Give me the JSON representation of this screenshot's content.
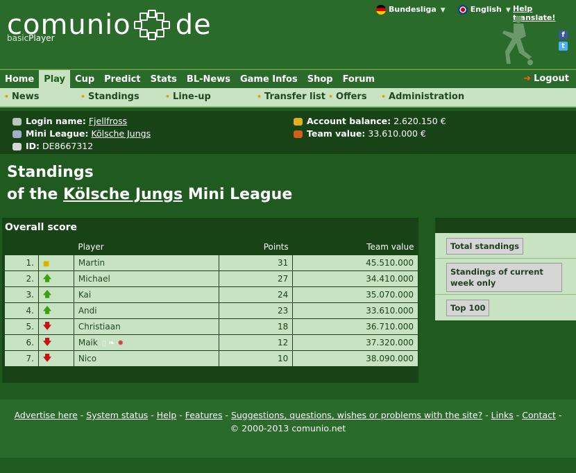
{
  "brand": {
    "name_left": "comunio",
    "name_right": "de",
    "sub_prefix": "basic",
    "sub_suffix": "Player"
  },
  "top": {
    "league": "Bundesliga",
    "language": "English",
    "help": "Help translate!",
    "fb": "f",
    "tw": "t"
  },
  "nav": {
    "items": [
      "Home",
      "Play",
      "Cup",
      "Predict",
      "Stats",
      "BL-News",
      "Game Infos",
      "Shop",
      "Forum"
    ],
    "active": "Play",
    "logout": "Logout"
  },
  "subnav": {
    "items": [
      "News",
      "Standings",
      "Line-up",
      "Transfer list",
      "Offers",
      "Administration"
    ]
  },
  "info": {
    "login_label": "Login name:",
    "login_value": "Fjellfross",
    "league_label": "Mini League:",
    "league_value": "Kölsche Jungs",
    "id_label": "ID:",
    "id_value": "DE8667312",
    "balance_label": "Account balance:",
    "balance_value": "2.620.150 €",
    "team_label": "Team value:",
    "team_value": "33.610.000 €"
  },
  "title": {
    "line1": "Standings",
    "line2_prefix": "of the",
    "line2_league": "Kölsche Jungs",
    "line2_suffix": "Mini League"
  },
  "standings": {
    "heading": "Overall score",
    "columns": {
      "player": "Player",
      "points": "Points",
      "team_value": "Team value"
    },
    "rows": [
      {
        "rank": "1.",
        "trend": "same",
        "player": "Martin",
        "points": "31",
        "value": "45.510.000"
      },
      {
        "rank": "2.",
        "trend": "up",
        "player": "Michael",
        "points": "27",
        "value": "34.410.000"
      },
      {
        "rank": "3.",
        "trend": "up",
        "player": "Kai",
        "points": "24",
        "value": "35.070.000"
      },
      {
        "rank": "4.",
        "trend": "up",
        "player": "Andi",
        "points": "23",
        "value": "33.610.000"
      },
      {
        "rank": "5.",
        "trend": "down",
        "player": "Christiaan",
        "points": "18",
        "value": "36.710.000"
      },
      {
        "rank": "6.",
        "trend": "down",
        "player": "Maik",
        "points": "12",
        "value": "37.320.000",
        "badges": true
      },
      {
        "rank": "7.",
        "trend": "down",
        "player": "Nico",
        "points": "10",
        "value": "38.090.000"
      }
    ]
  },
  "sidebar": {
    "total": "Total standings",
    "current": "Standings of current week only",
    "top100": "Top 100"
  },
  "footer": {
    "links": [
      "Advertise here",
      "System status",
      "Help",
      "Features",
      "Suggestions, questions, wishes or problems with the site?",
      "Links",
      "Contact"
    ],
    "copyright": "© 2000-2013 comunio.net"
  },
  "colors": {
    "bg": "#1f5a1f",
    "header": "#2a6a2a",
    "light": "#c7e3c1",
    "dark": "#174317"
  }
}
